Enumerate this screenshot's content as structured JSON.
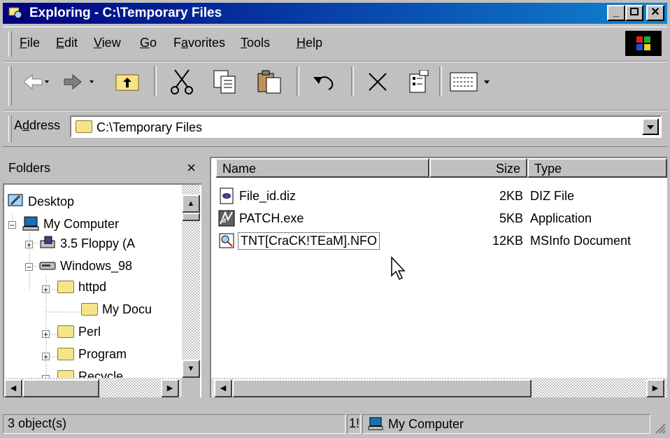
{
  "window": {
    "title": "Exploring - C:\\Temporary Files"
  },
  "menu": [
    {
      "label": "File"
    },
    {
      "label": "Edit"
    },
    {
      "label": "View"
    },
    {
      "label": "Go"
    },
    {
      "label": "Favorites"
    },
    {
      "label": "Tools"
    },
    {
      "label": "Help"
    }
  ],
  "address": {
    "label": "Address",
    "value": "C:\\Temporary Files"
  },
  "folders": {
    "title": "Folders",
    "close": "×",
    "items": [
      {
        "label": "Desktop"
      },
      {
        "label": "My Computer"
      },
      {
        "label": "3.5 Floppy (A"
      },
      {
        "label": "Windows_98"
      },
      {
        "label": "httpd"
      },
      {
        "label": "My Docu"
      },
      {
        "label": "Perl"
      },
      {
        "label": "Program"
      },
      {
        "label": "Recycle"
      }
    ]
  },
  "columns": {
    "name": "Name",
    "size": "Size",
    "type": "Type"
  },
  "files": [
    {
      "name": "File_id.diz",
      "size": "2KB",
      "type": "DIZ File",
      "icon": "diz-file-icon"
    },
    {
      "name": "PATCH.exe",
      "size": "5KB",
      "type": "Application",
      "icon": "exe-file-icon"
    },
    {
      "name": "TNT[CraCK!TEaM].NFO",
      "size": "12KB",
      "type": "MSInfo Document",
      "icon": "nfo-file-icon"
    }
  ],
  "status": {
    "count": "3 object(s)",
    "size": "1!",
    "location": "My Computer"
  },
  "colors": {
    "title_start": "#000080",
    "title_end": "#1084d0",
    "face": "#c0c0c0"
  }
}
